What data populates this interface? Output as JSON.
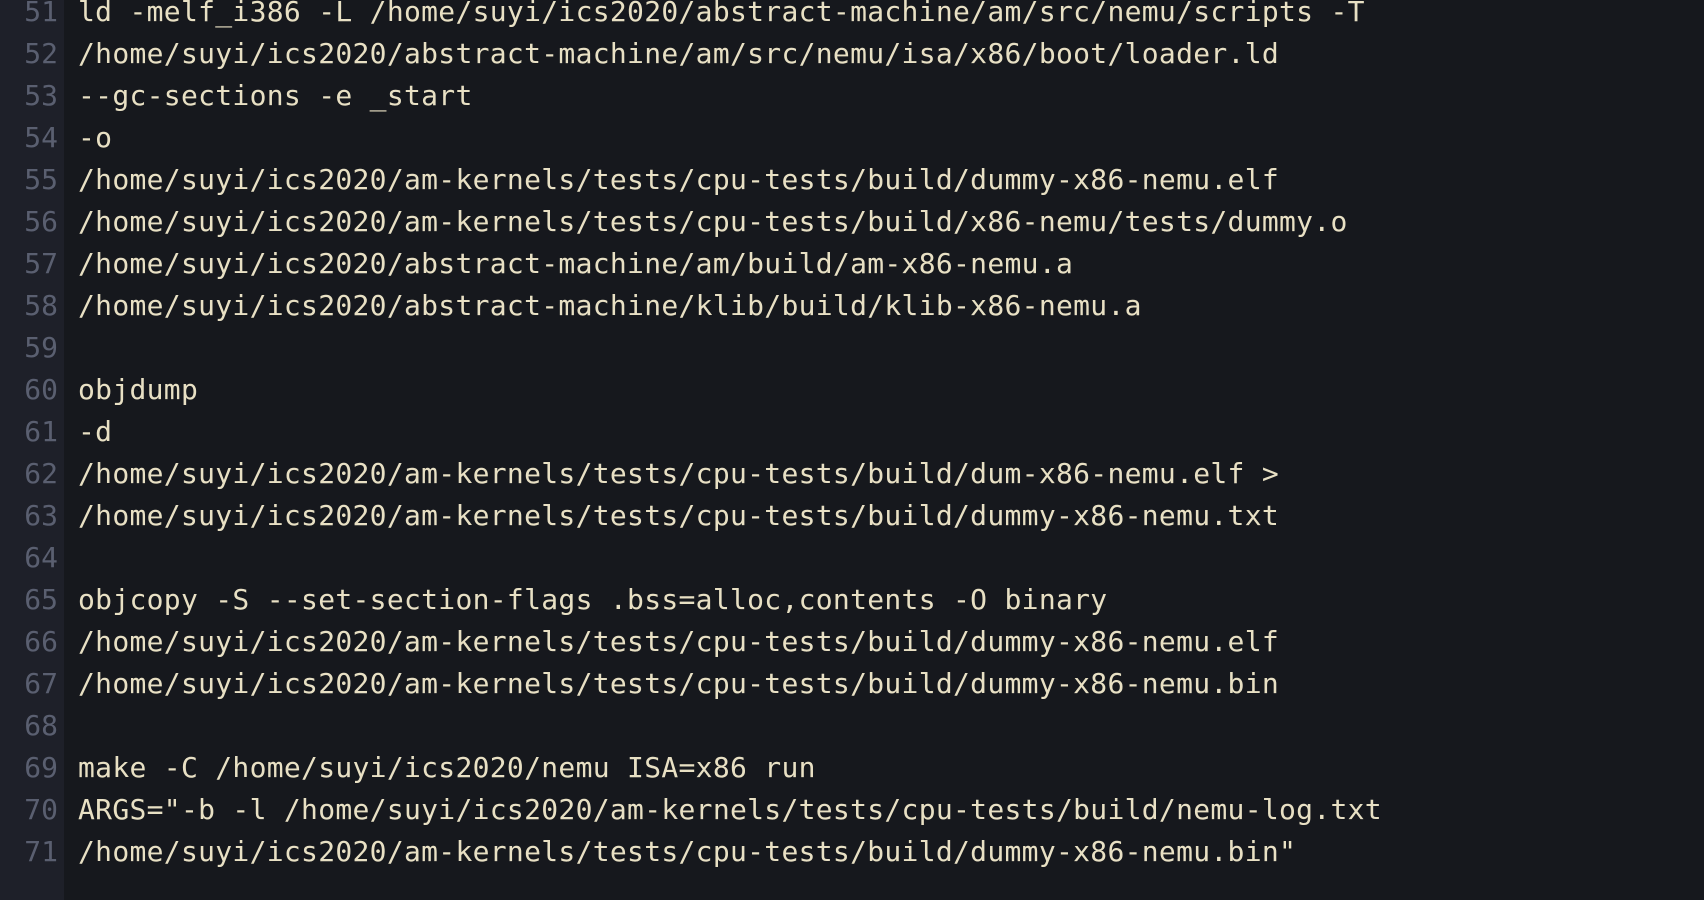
{
  "editor": {
    "lines": [
      {
        "number": "51",
        "text": "ld -melf_i386 -L /home/suyi/ics2020/abstract-machine/am/src/nemu/scripts -T"
      },
      {
        "number": "52",
        "text": "/home/suyi/ics2020/abstract-machine/am/src/nemu/isa/x86/boot/loader.ld"
      },
      {
        "number": "53",
        "text": "--gc-sections -e _start"
      },
      {
        "number": "54",
        "text": "-o"
      },
      {
        "number": "55",
        "text": "/home/suyi/ics2020/am-kernels/tests/cpu-tests/build/dummy-x86-nemu.elf"
      },
      {
        "number": "56",
        "text": "/home/suyi/ics2020/am-kernels/tests/cpu-tests/build/x86-nemu/tests/dummy.o"
      },
      {
        "number": "57",
        "text": "/home/suyi/ics2020/abstract-machine/am/build/am-x86-nemu.a"
      },
      {
        "number": "58",
        "text": "/home/suyi/ics2020/abstract-machine/klib/build/klib-x86-nemu.a"
      },
      {
        "number": "59",
        "text": ""
      },
      {
        "number": "60",
        "text": "objdump"
      },
      {
        "number": "61",
        "text": "-d"
      },
      {
        "number": "62",
        "text": "/home/suyi/ics2020/am-kernels/tests/cpu-tests/build/dum-x86-nemu.elf >"
      },
      {
        "number": "63",
        "text": "/home/suyi/ics2020/am-kernels/tests/cpu-tests/build/dummy-x86-nemu.txt"
      },
      {
        "number": "64",
        "text": ""
      },
      {
        "number": "65",
        "text": "objcopy -S --set-section-flags .bss=alloc,contents -O binary"
      },
      {
        "number": "66",
        "text": "/home/suyi/ics2020/am-kernels/tests/cpu-tests/build/dummy-x86-nemu.elf"
      },
      {
        "number": "67",
        "text": "/home/suyi/ics2020/am-kernels/tests/cpu-tests/build/dummy-x86-nemu.bin"
      },
      {
        "number": "68",
        "text": ""
      },
      {
        "number": "69",
        "text": "make -C /home/suyi/ics2020/nemu ISA=x86 run"
      },
      {
        "number": "70",
        "text": "ARGS=\"-b -l /home/suyi/ics2020/am-kernels/tests/cpu-tests/build/nemu-log.txt"
      },
      {
        "number": "71",
        "text": "/home/suyi/ics2020/am-kernels/tests/cpu-tests/build/dummy-x86-nemu.bin\""
      }
    ]
  },
  "colors": {
    "background": "#16181d",
    "gutter_background": "#1e2029",
    "line_number": "#5a5f70",
    "text": "#e8e0c4"
  }
}
